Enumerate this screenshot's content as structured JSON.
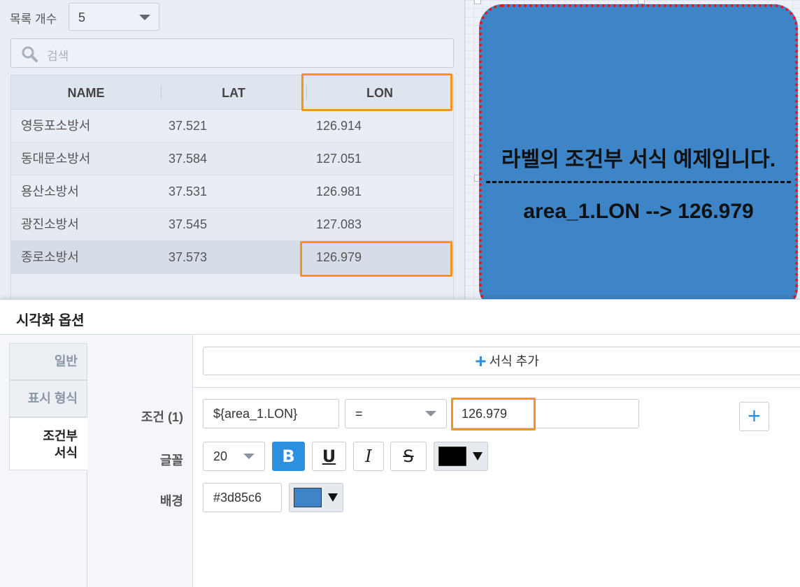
{
  "list": {
    "count_label": "목록 개수",
    "count_value": "5",
    "search_placeholder": "검색",
    "columns": [
      "NAME",
      "LAT",
      "LON"
    ],
    "rows": [
      {
        "name": "영등포소방서",
        "lat": "37.521",
        "lon": "126.914"
      },
      {
        "name": "동대문소방서",
        "lat": "37.584",
        "lon": "127.051"
      },
      {
        "name": "용산소방서",
        "lat": "37.531",
        "lon": "126.981"
      },
      {
        "name": "광진소방서",
        "lat": "37.545",
        "lon": "127.083"
      },
      {
        "name": "종로소방서",
        "lat": "37.573",
        "lon": "126.979"
      }
    ],
    "selected_row_index": 4
  },
  "canvas": {
    "label_line1": "라벨의 조건부 서식 예제입니다.",
    "label_line2": "area_1.LON --> 126.979",
    "background_color": "#3d85c6",
    "border_color": "#e8141a"
  },
  "options": {
    "title": "시각화 옵션",
    "tabs": [
      "일반",
      "표시 형식",
      "조건부\n서식"
    ],
    "active_tab_index": 2,
    "add_format_label": "서식 추가",
    "condition_label": "조건 (1)",
    "font_label": "글꼴",
    "background_label": "배경",
    "condition_field": "${area_1.LON}",
    "operator": "=",
    "condition_value": "126.979",
    "font_size": "20",
    "bold_on": true,
    "font_color": "#000000",
    "background_hex": "#3d85c6",
    "icons": {
      "bold": "bold-icon",
      "underline": "underline-icon",
      "italic": "italic-icon",
      "strikethrough": "strikethrough-icon",
      "add": "plus-icon",
      "search": "search-icon"
    },
    "highlight_color": "#f39321"
  }
}
